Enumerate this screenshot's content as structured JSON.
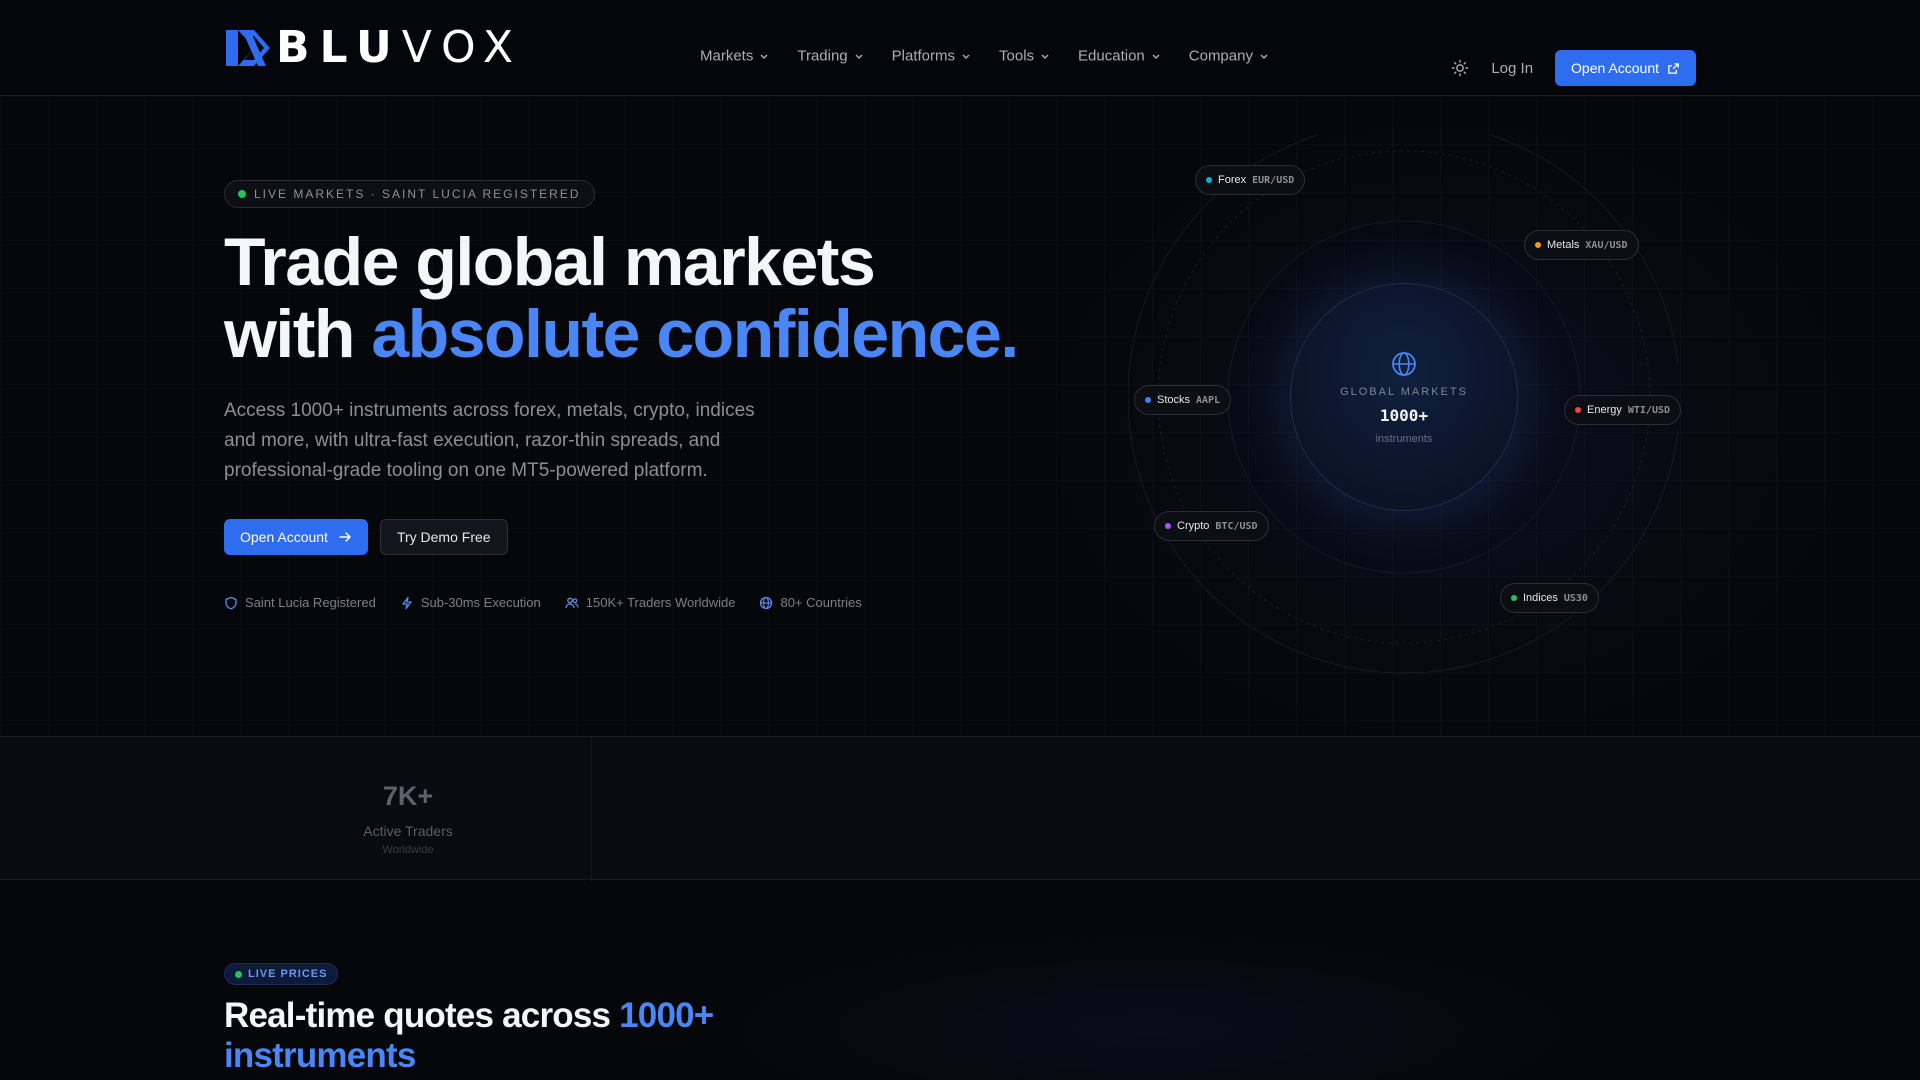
{
  "brand": {
    "name_bold": "BLU",
    "name_light": "VOX",
    "accent": "#2f6df0"
  },
  "nav": {
    "items": [
      "Markets",
      "Trading",
      "Platforms",
      "Tools",
      "Education",
      "Company"
    ],
    "login": "Log In",
    "open_account": "Open Account"
  },
  "hero": {
    "badge": "LIVE MARKETS · SAINT LUCIA REGISTERED",
    "title_line1": "Trade global markets",
    "title_line2_plain": "with ",
    "title_line2_accent": "absolute confidence.",
    "description": "Access 1000+ instruments across forex, metals, crypto, indices and more, with ultra-fast execution, razor-thin spreads, and professional-grade tooling on one MT5-powered platform.",
    "primary_cta": "Open Account",
    "secondary_cta": "Try Demo Free",
    "trust": [
      {
        "icon": "shield-icon",
        "label": "Saint Lucia Registered"
      },
      {
        "icon": "bolt-icon",
        "label": "Sub-30ms Execution"
      },
      {
        "icon": "users-icon",
        "label": "150K+ Traders Worldwide"
      },
      {
        "icon": "globe-icon",
        "label": "80+ Countries"
      }
    ]
  },
  "orbit": {
    "core_label": "GLOBAL MARKETS",
    "core_value": "1000+",
    "core_sub": "instruments",
    "markets": [
      {
        "name": "Forex",
        "symbol": "EUR/USD",
        "color": "#06b6d4"
      },
      {
        "name": "Metals",
        "symbol": "XAU/USD",
        "color": "#f59e0b"
      },
      {
        "name": "Stocks",
        "symbol": "AAPL",
        "color": "#3b82f6"
      },
      {
        "name": "Energy",
        "symbol": "WTI/USD",
        "color": "#ef4444"
      },
      {
        "name": "Crypto",
        "symbol": "BTC/USD",
        "color": "#a855f7"
      },
      {
        "name": "Indices",
        "symbol": "US30",
        "color": "#22c55e"
      }
    ]
  },
  "stats": {
    "value": "7K+",
    "label": "Active Traders",
    "sub": "Worldwide"
  },
  "live": {
    "badge": "LIVE PRICES",
    "title_plain": "Real-time quotes across ",
    "title_accent": "1000+ instruments"
  }
}
